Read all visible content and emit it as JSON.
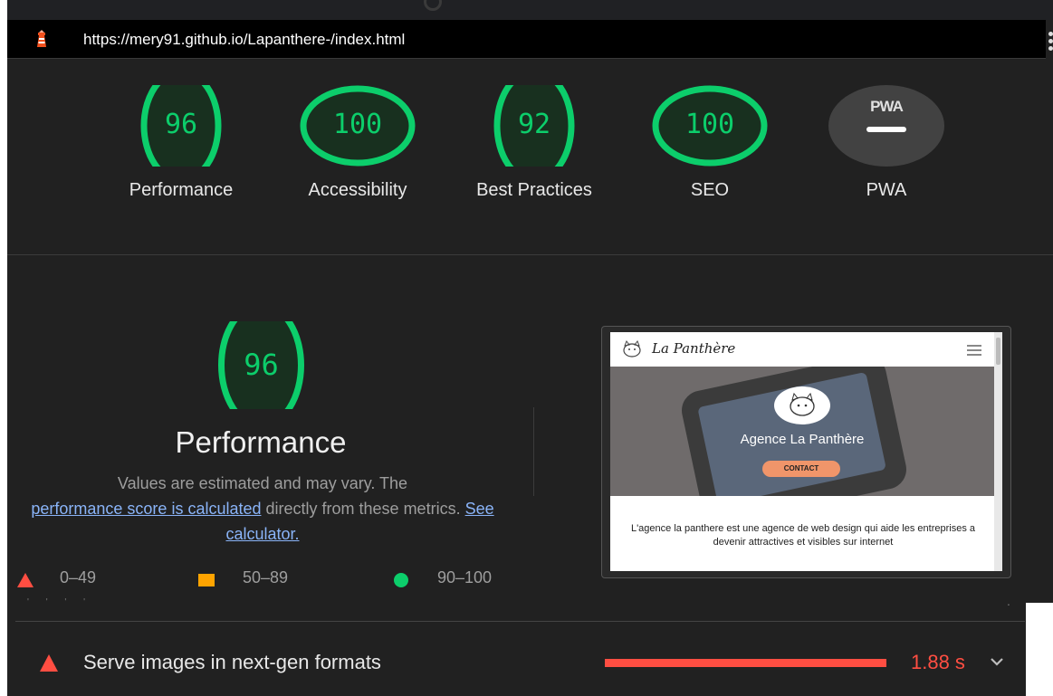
{
  "url": "https://mery91.github.io/Lapanthere-/index.html",
  "colors": {
    "pass": "#0cce6b",
    "average": "#ffa400",
    "fail": "#ff4e42",
    "background": "#212121"
  },
  "categories": [
    {
      "label": "Performance",
      "score": "96",
      "value": 96
    },
    {
      "label": "Accessibility",
      "score": "100",
      "value": 100
    },
    {
      "label": "Best Practices",
      "score": "92",
      "value": 92
    },
    {
      "label": "SEO",
      "score": "100",
      "value": 100
    }
  ],
  "pwa": {
    "badge": "PWA",
    "label": "PWA"
  },
  "performance": {
    "score": "96",
    "value": 96,
    "title": "Performance",
    "desc_prefix": "Values are estimated and may vary. The",
    "desc_link": "performance score is calculated",
    "desc_middle": "directly from these metrics.",
    "desc_link2": "See calculator."
  },
  "legend": {
    "fail": "0–49",
    "average": "50–89",
    "pass": "90–100"
  },
  "screenshot": {
    "brand": "La Panthère",
    "hero_title": "Agence La Panthère",
    "hero_button": "CONTACT",
    "body_text": "L'agence la panthere est une agence de web design qui aide les entreprises a devenir attractives et visibles sur internet"
  },
  "audit": {
    "title": "Serve images in next-gen formats",
    "value": "1.88 s",
    "savings_seconds": 1.88
  }
}
